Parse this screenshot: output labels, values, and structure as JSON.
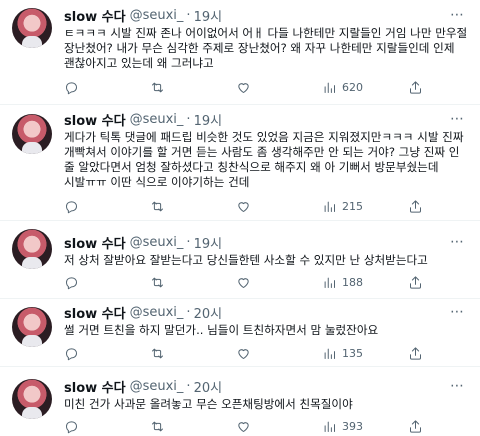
{
  "author": {
    "name": "slow 수다",
    "handle": "@seuxi_",
    "dot": "·"
  },
  "more_glyph": "⋯",
  "tweets": [
    {
      "time": "19시",
      "text": "ㅌㅋㅋㅋ 시발 진짜 존나 어이없어서 어ㅐ 다들 나한테만 지랄들인 거임 나만 만우절 장난쳤어? 내가 무슨 심각한 주제로 장난쳤어? 왜 자꾸 나한테만 지랄들인데 인제 괜찮아지고 있는데 왜 그러냐고",
      "views": "620"
    },
    {
      "time": "19시",
      "text": "게다가 틱톡 댓글에 패드립 비슷한 것도 있었음 지금은 지워졌지만ㅋㅋㅋ 시발 진짜 개빡쳐서 이야기를 할 거면 듣는 사람도 좀 생각해주만 안 되는 거야? 그냥 진짜 인 줄 알았다면서 엄청 잘하셨다고 칭찬식으로 해주지 왜 아 기뻐서 방문부쉈는데 시발ㅠㅠ 이딴 식으로 이야기하는 건데",
      "views": "215"
    },
    {
      "time": "19시",
      "text": "저 상처 잘받아요 잘받는다고 당신들한텐 사소할 수 있지만 난 상처받는다고",
      "views": "188"
    },
    {
      "time": "20시",
      "text": "썰 거면 트친을 하지 말던가.. 님들이 트친하자면서 맘 눌렀잔아요",
      "views": "135"
    },
    {
      "time": "20시",
      "text": "미친 건가 사과문 올려놓고 무슨 오픈채팅방에서 친목질이야",
      "views": "393"
    }
  ]
}
